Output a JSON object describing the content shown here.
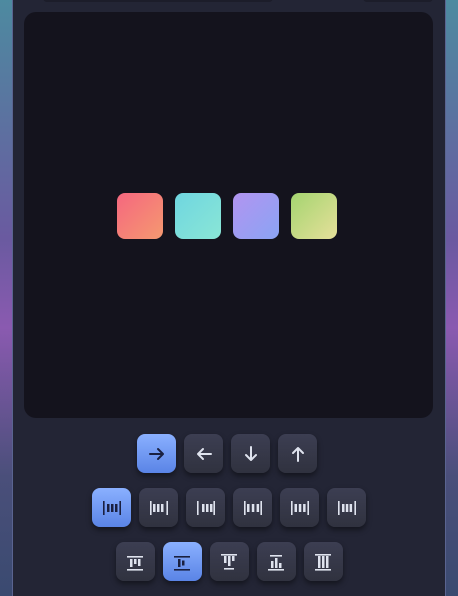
{
  "title_fragment": "",
  "tiles": [
    {
      "name": "tile-coral",
      "color": "#f5677f"
    },
    {
      "name": "tile-aqua",
      "color": "#6fd6e0"
    },
    {
      "name": "tile-lavender",
      "color": "#b294f0"
    },
    {
      "name": "tile-lime",
      "color": "#a4d470"
    }
  ],
  "flex_direction": {
    "selected": "row",
    "options": [
      {
        "value": "row",
        "icon": "arrow-right-icon"
      },
      {
        "value": "row-reverse",
        "icon": "arrow-left-icon"
      },
      {
        "value": "column",
        "icon": "arrow-down-icon"
      },
      {
        "value": "column-reverse",
        "icon": "arrow-up-icon"
      }
    ]
  },
  "justify_content": {
    "selected": "flex-start",
    "options": [
      "flex-start",
      "flex-end",
      "center",
      "space-between",
      "space-around",
      "space-evenly"
    ]
  },
  "align_items": {
    "selected": "center",
    "options": [
      "flex-start",
      "center",
      "flex-end",
      "baseline",
      "stretch"
    ]
  },
  "colors": {
    "accent": "#6f97f5",
    "panel": "#232535",
    "stage": "#14131d"
  }
}
